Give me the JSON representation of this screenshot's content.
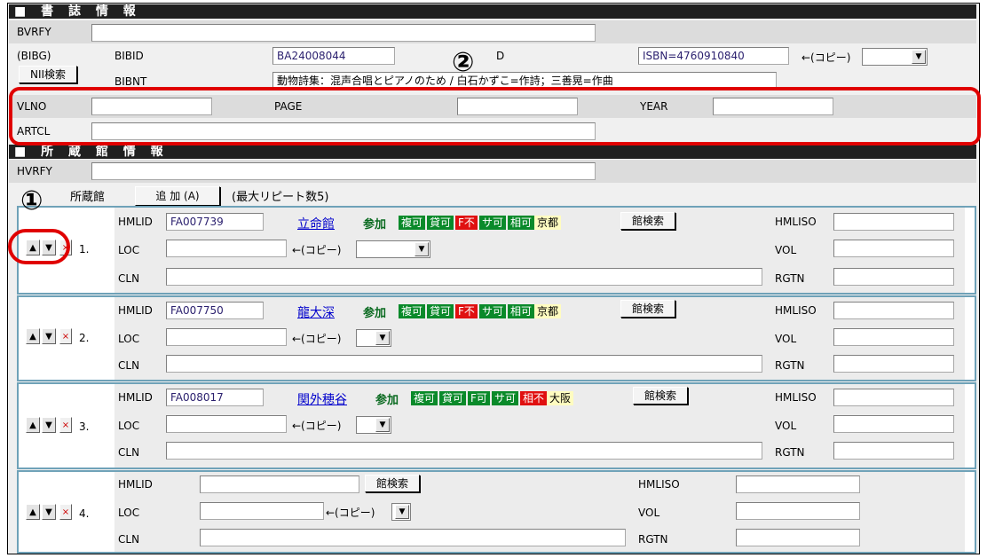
{
  "bib": {
    "header": "■ 書 誌 情 報",
    "bvrfy_label": "BVRFY",
    "bibg_label": "(BIBG)",
    "nii_button": "NII検索",
    "bibid_label": "BIBID",
    "bibid_value": "BA24008044",
    "id_partial": "D",
    "isbn_value": "ISBN=4760910840",
    "copy_label": "←(コピー)",
    "bibnt_label": "BIBNT",
    "bibnt_value": "動物詩集：混声合唱とピアノのため / 白石かずこ=作詩；三善晃=作曲",
    "vlno_label": "VLNO",
    "page_label": "PAGE",
    "year_label": "YEAR",
    "artcl_label": "ARTCL"
  },
  "holdings": {
    "header": "■ 所 蔵 館 情 報",
    "hvrfy_label": "HVRFY",
    "tab_label": "所蔵館",
    "add_button": "追 加 (A)",
    "max_repeat": "(最大リピート数5)",
    "hmlid_label": "HMLID",
    "loc_label": "LOC",
    "cln_label": "CLN",
    "hmliso_label": "HMLISO",
    "vol_label": "VOL",
    "rgtn_label": "RGTN",
    "search_button": "館検索",
    "copy_label": "←(コピー)",
    "join_label": "参加",
    "up_glyph": "▲",
    "down_glyph": "▼",
    "remove_glyph": "×",
    "rows": [
      {
        "num": "1.",
        "hmlid": "FA007739",
        "name": "立命館",
        "b1": "複可",
        "b2": "貸可",
        "b3": "F不",
        "b4": "サ可",
        "b5": "相可",
        "region": "京都"
      },
      {
        "num": "2.",
        "hmlid": "FA007750",
        "name": "龍大深",
        "b1": "複可",
        "b2": "貸可",
        "b3": "F不",
        "b4": "サ可",
        "b5": "相可",
        "region": "京都"
      },
      {
        "num": "3.",
        "hmlid": "FA008017",
        "name": "関外穂谷",
        "b1": "複可",
        "b2": "貸可",
        "b3": "F可",
        "b4": "サ可",
        "b5": "相不",
        "region": "大阪"
      },
      {
        "num": "4.",
        "hmlid": ""
      }
    ]
  },
  "annotations": {
    "circle1": "①",
    "circle2": "②"
  },
  "colors": {
    "ok_badge": "#0a8a2a",
    "ng_badge": "#e01010",
    "annotation_red": "#e00000",
    "block_border": "#6fa2b8"
  }
}
